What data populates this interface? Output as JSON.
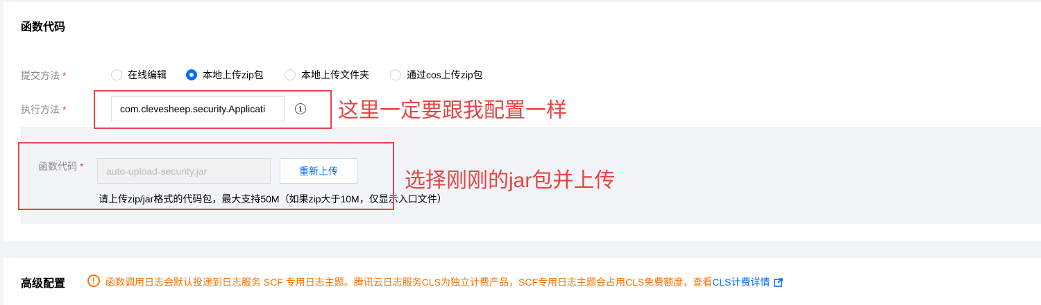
{
  "function_code_section": {
    "title": "函数代码",
    "submit_method": {
      "label": "提交方法",
      "options": [
        "在线编辑",
        "本地上传zip包",
        "本地上传文件夹",
        "通过cos上传zip包"
      ],
      "selected_index": 1
    },
    "handler": {
      "label": "执行方法",
      "value": "com.clevesheep.security.Applicati"
    },
    "upload": {
      "label": "函数代码",
      "file_value": "auto-upload-security.jar",
      "reupload_button": "重新上传",
      "hint": "请上传zip/jar格式的代码包，最大支持50M（如果zip大于10M，仅显示入口文件）"
    },
    "required_mark": "*"
  },
  "annotations": {
    "handler_note": "这里一定要跟我配置一样",
    "upload_note": "选择刚刚的jar包并上传"
  },
  "advanced_section": {
    "title": "高级配置",
    "notice_text": "函数调用日志会默认投递到日志服务 SCF 专用日志主题。腾讯云日志服务CLS为独立计费产品，SCF专用日志主题会占用CLS免费额度，查看",
    "notice_link": "CLS计费详情"
  },
  "colors": {
    "accent": "#006eff",
    "annotation_red": "#e54545",
    "warning_orange": "#ff7200"
  },
  "icons": [
    "info-icon",
    "warning-icon",
    "external-link-icon"
  ]
}
